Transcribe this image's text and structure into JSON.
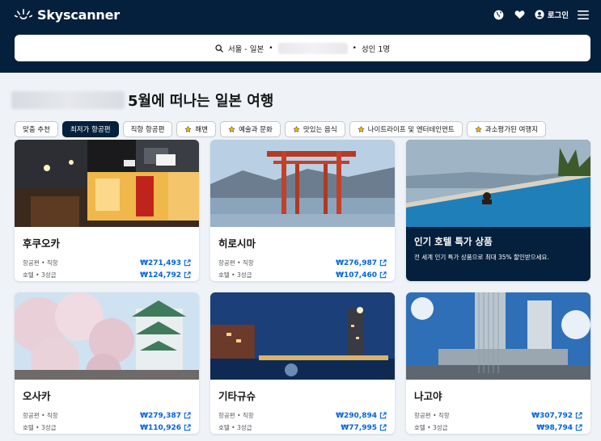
{
  "brand": {
    "name": "Skyscanner"
  },
  "header": {
    "login_label": "로그인",
    "icons": [
      "globe-icon",
      "heart-icon",
      "account-icon",
      "menu-icon"
    ]
  },
  "search": {
    "route": "서울 - 일본",
    "passengers": "성인 1명",
    "separator": "•"
  },
  "page": {
    "title": "5월에 떠나는 일본 여행"
  },
  "chips": [
    {
      "label": "맞춤 추천",
      "active": false,
      "icon": false
    },
    {
      "label": "최저가 항공편",
      "active": true,
      "icon": false
    },
    {
      "label": "직항 항공편",
      "active": false,
      "icon": false
    },
    {
      "label": "해변",
      "active": false,
      "icon": true
    },
    {
      "label": "예술과 문화",
      "active": false,
      "icon": true
    },
    {
      "label": "맛있는 음식",
      "active": false,
      "icon": true
    },
    {
      "label": "나이트라이프 및 엔터테인먼트",
      "active": false,
      "icon": true
    },
    {
      "label": "과소평가된 여행지",
      "active": false,
      "icon": true
    }
  ],
  "cards": [
    {
      "city": "후쿠오카",
      "flight_label": "항공편 • 직항",
      "flight_price": "₩271,493",
      "hotel_label": "호텔 • 3성급",
      "hotel_price": "₩124,792"
    },
    {
      "city": "히로시마",
      "flight_label": "항공편 • 직항",
      "flight_price": "₩276,987",
      "hotel_label": "호텔 • 3성급",
      "hotel_price": "₩107,460"
    },
    {
      "promo_title": "인기 호텔 특가 상품",
      "promo_text": "전 세계 인기 특가 상품으로 최대 35% 할인받으세요."
    },
    {
      "city": "오사카",
      "flight_label": "항공편 • 직항",
      "flight_price": "₩279,387",
      "hotel_label": "호텔 • 3성급",
      "hotel_price": "₩110,926"
    },
    {
      "city": "기타규슈",
      "flight_label": "항공편 • 직항",
      "flight_price": "₩290,894",
      "hotel_label": "호텔 • 3성급",
      "hotel_price": "₩77,995"
    },
    {
      "city": "나고야",
      "flight_label": "항공편 • 직항",
      "flight_price": "₩307,792",
      "hotel_label": "호텔 • 3성급",
      "hotel_price": "₩98,794"
    }
  ],
  "colors": {
    "navy": "#05203c",
    "link_blue": "#0062e3",
    "background": "#eff3f8"
  }
}
